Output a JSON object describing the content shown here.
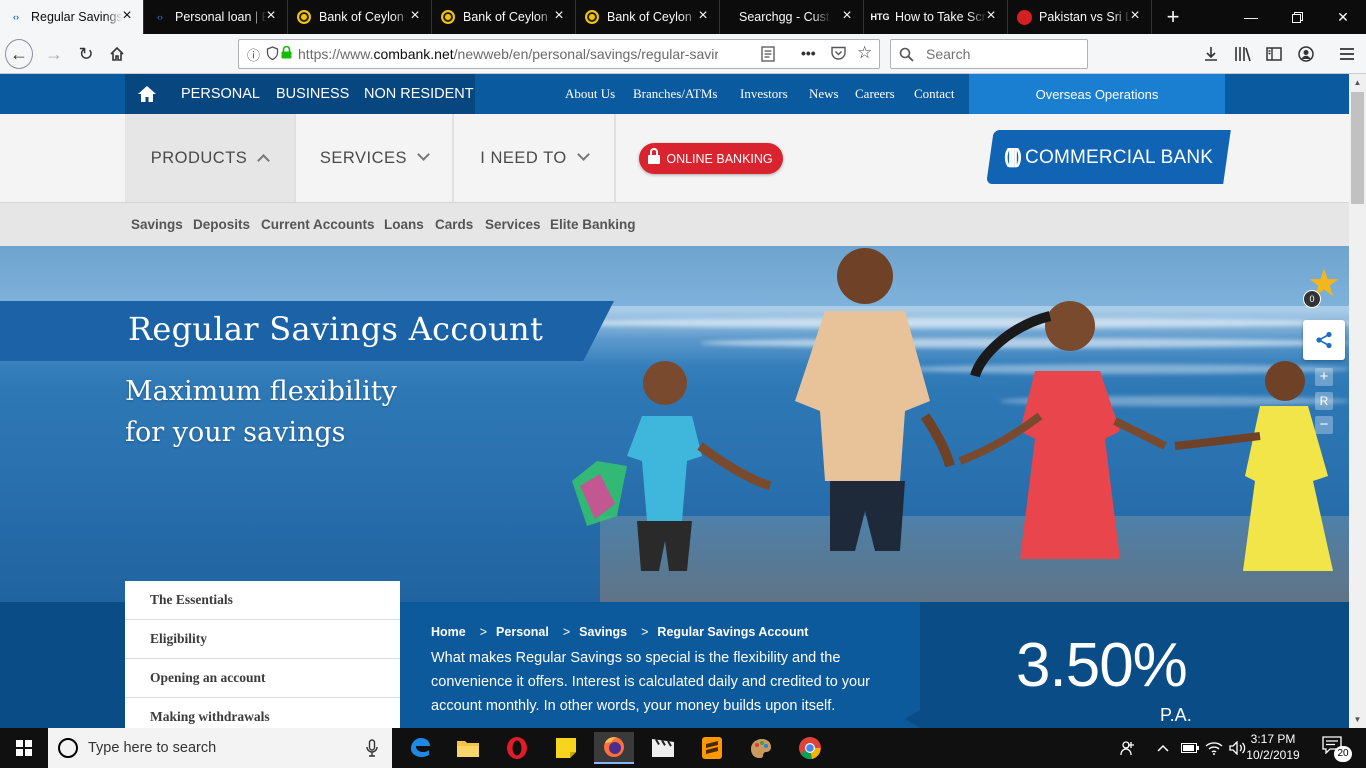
{
  "browser": {
    "tabs": [
      {
        "title": "Regular Savings Acco",
        "active": true,
        "favicon": "commercial-bank-favicon"
      },
      {
        "title": "Personal loan | Busi",
        "active": false,
        "favicon": "commercial-bank-favicon"
      },
      {
        "title": "Bank of Ceylon",
        "active": false,
        "favicon": "boc-favicon"
      },
      {
        "title": "Bank of Ceylon",
        "active": false,
        "favicon": "boc-favicon"
      },
      {
        "title": "Bank of Ceylon",
        "active": false,
        "favicon": "boc-favicon"
      },
      {
        "title": "Searchgg - Custom Se",
        "active": false,
        "favicon": "none"
      },
      {
        "title": "How to Take Screensh",
        "active": false,
        "favicon": "htg-favicon"
      },
      {
        "title": "Pakistan vs Sri Lanka",
        "active": false,
        "favicon": "cricket-favicon"
      }
    ],
    "htg_label": "HTG",
    "url_prefix": "https://www.",
    "url_domain": "combank.net",
    "url_path": "/newweb/en/personal/savings/regular-savings-account",
    "search_placeholder": "Search",
    "overflow_icon": "•••"
  },
  "site": {
    "segments": [
      "PERSONAL",
      "BUSINESS",
      "NON RESIDENT"
    ],
    "top_links": [
      "About Us",
      "Branches/ATMs",
      "Investors",
      "News",
      "Careers",
      "Contact"
    ],
    "overseas": "Overseas Operations",
    "menu": [
      "PRODUCTS",
      "SERVICES",
      "I NEED TO"
    ],
    "online_banking": "ONLINE BANKING",
    "logo_text": "COMMERCIAL BANK",
    "submenu": [
      "Savings",
      "Deposits",
      "Current Accounts",
      "Loans",
      "Cards",
      "Services",
      "Elite Banking"
    ]
  },
  "hero": {
    "title": "Regular Savings Account",
    "tagline_line1": "Maximum flexibility",
    "tagline_line2": "for your savings",
    "favourite_count": "0",
    "zoom_in": "+",
    "zoom_reset": "R",
    "zoom_out": "−"
  },
  "sidenav": [
    "The Essentials",
    "Eligibility",
    "Opening an account",
    "Making withdrawals"
  ],
  "breadcrumb": [
    "Home",
    "Personal",
    "Savings",
    "Regular Savings Account"
  ],
  "breadcrumb_sep": ">",
  "intro": "What makes Regular Savings so special is the flexibility and the convenience it offers. Interest is calculated daily and credited to your account monthly. In other words, your money builds upon itself.",
  "rate": {
    "value": "3.50%",
    "suffix": "P.A."
  },
  "taskbar": {
    "search_placeholder": "Type here to search",
    "time": "3:17 PM",
    "date": "10/2/2019",
    "notification_count": "20",
    "apps": [
      "edge-icon",
      "file-explorer-icon",
      "opera-icon",
      "sticky-notes-icon",
      "firefox-icon",
      "video-editor-icon",
      "sublime-text-icon",
      "paint-app-icon",
      "chrome-icon"
    ]
  },
  "colors": {
    "brand_blue": "#0a5a9f",
    "brand_dark": "#08467f",
    "online_banking_red": "#d9232e",
    "star_gold": "#f3b61b"
  }
}
